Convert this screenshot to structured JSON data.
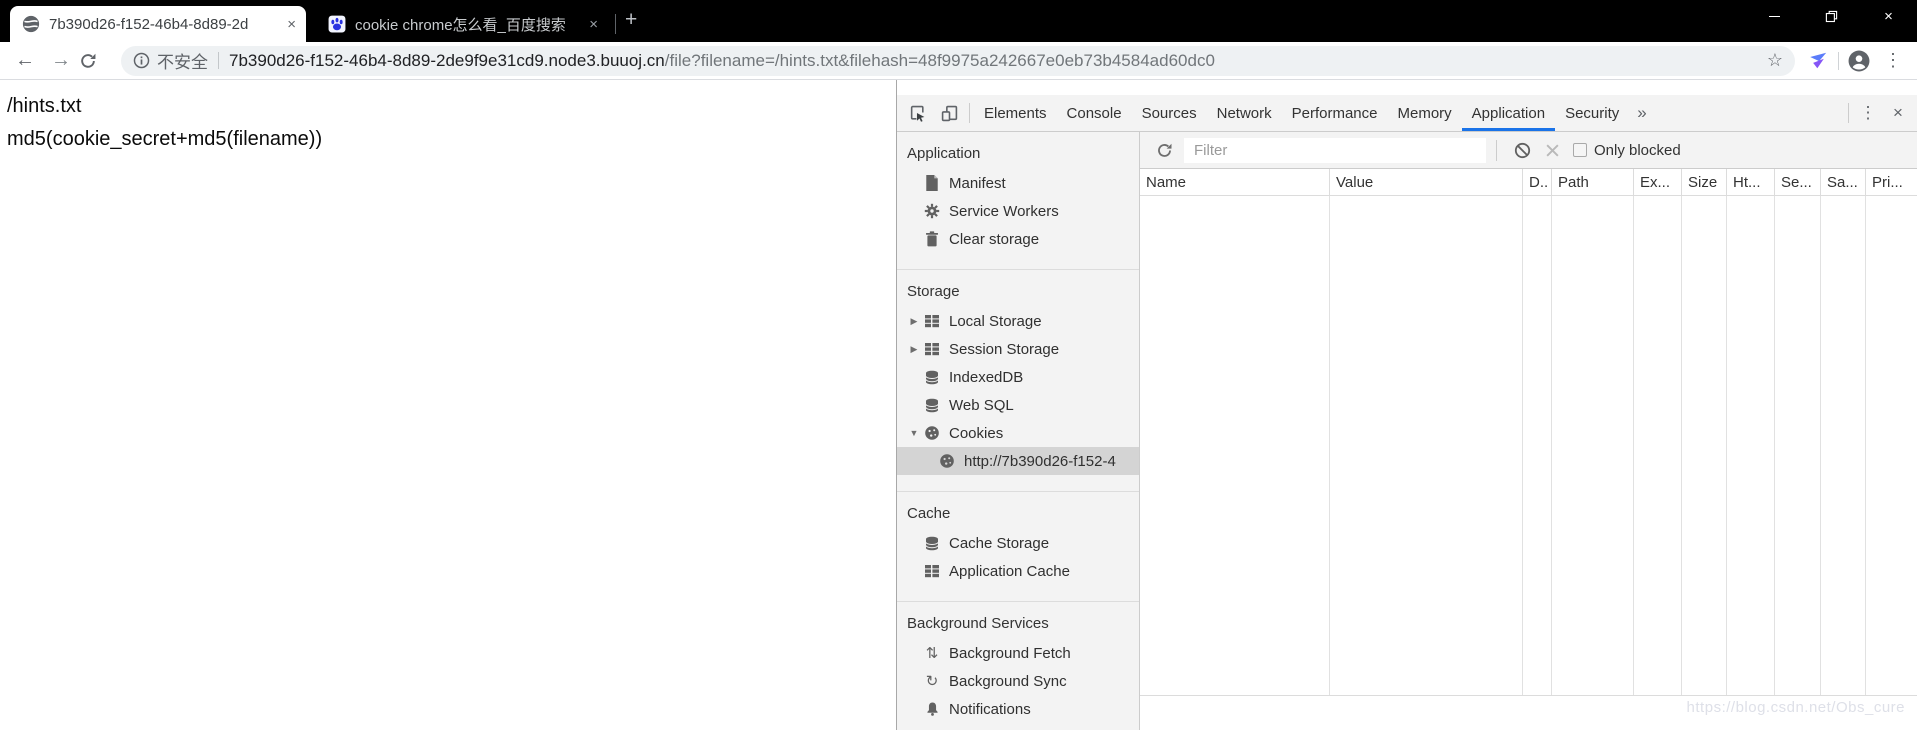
{
  "window": {
    "tabs": [
      {
        "title": "7b390d26-f152-46b4-8d89-2d",
        "close_glyph": "×"
      },
      {
        "title": "cookie chrome怎么看_百度搜索",
        "close_glyph": "×"
      }
    ],
    "new_tab_glyph": "+",
    "controls": {
      "close_glyph": "×"
    }
  },
  "toolbar": {
    "back_glyph": "←",
    "forward_glyph": "→",
    "security_label": "不安全",
    "url_domain": "7b390d26-f152-46b4-8d89-2de9f9e31cd9.node3.buuoj.cn",
    "url_path": "/file?filename=/hints.txt&filehash=48f9975a242667e0eb73b4584ad60dc0",
    "bookmark_star_glyph": "☆",
    "menu_glyph": "⋮"
  },
  "page": {
    "line1": "/hints.txt",
    "line2": "md5(cookie_secret+md5(filename))"
  },
  "devtools": {
    "tabs": [
      {
        "label": "Elements"
      },
      {
        "label": "Console"
      },
      {
        "label": "Sources"
      },
      {
        "label": "Network"
      },
      {
        "label": "Performance"
      },
      {
        "label": "Memory"
      },
      {
        "label": "Application"
      },
      {
        "label": "Security"
      }
    ],
    "more_tabs_glyph": "»",
    "menu_glyph": "⋮",
    "close_glyph": "×",
    "sidebar": {
      "app_header": "Application",
      "manifest": "Manifest",
      "service_workers": "Service Workers",
      "clear_storage": "Clear storage",
      "storage_header": "Storage",
      "local_storage": "Local Storage",
      "session_storage": "Session Storage",
      "indexeddb": "IndexedDB",
      "web_sql": "Web SQL",
      "cookies": "Cookies",
      "cookie_origin": "http://7b390d26-f152-4",
      "cache_header": "Cache",
      "cache_storage": "Cache Storage",
      "application_cache": "Application Cache",
      "bg_header": "Background Services",
      "bg_fetch": "Background Fetch",
      "bg_sync": "Background Sync",
      "notifications": "Notifications",
      "collapsed_glyph": "▶",
      "expanded_glyph": "▼",
      "fetch_glyph": "⇅",
      "sync_glyph": "↻"
    },
    "cookies_panel": {
      "filter_placeholder": "Filter",
      "only_blocked_label": "Only blocked",
      "columns": [
        "Name",
        "Value",
        "D..",
        "Path",
        "Ex...",
        "Size",
        "Ht...",
        "Se...",
        "Sa...",
        "Pri..."
      ]
    }
  },
  "watermark": "https://blog.csdn.net/Obs_cure",
  "colors": {
    "accent_blue": "#1a73e8",
    "titlebar": "#000000",
    "devtools_chrome": "#f3f3f3",
    "selected_row": "#d4d4d4",
    "icon_gray": "#616161",
    "baidu_blue": "#2932e1"
  }
}
